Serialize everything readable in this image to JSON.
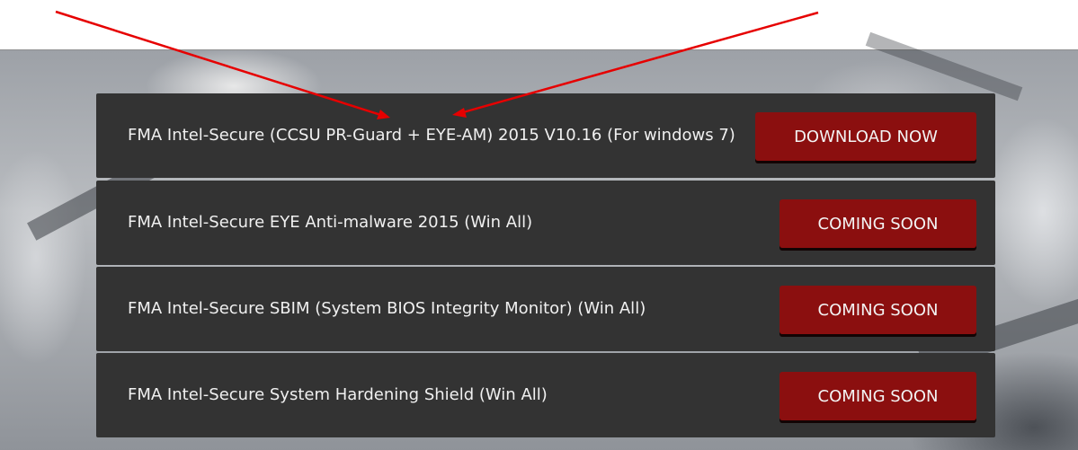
{
  "downloads": [
    {
      "title": "FMA Intel-Secure (CCSU PR-Guard + EYE-AM) 2015 V10.16 (For windows 7)",
      "action_label": "DOWNLOAD NOW"
    },
    {
      "title": "FMA Intel-Secure EYE Anti-malware 2015 (Win All)",
      "action_label": "COMING SOON"
    },
    {
      "title": "FMA Intel-Secure SBIM (System BIOS Integrity Monitor) (Win All)",
      "action_label": "COMING SOON"
    },
    {
      "title": "FMA Intel-Secure System Hardening Shield (Win All)",
      "action_label": "COMING SOON"
    }
  ],
  "colors": {
    "row_background": "#333333",
    "button_red": "#8b0f0f",
    "annotation_arrow": "#e60000"
  },
  "annotations": {
    "arrow_count": 2,
    "arrow_target": "row-1-title"
  }
}
